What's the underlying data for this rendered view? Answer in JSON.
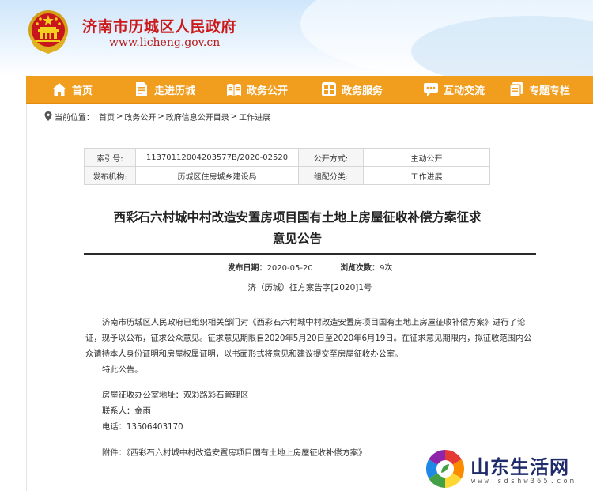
{
  "site": {
    "title": "济南市历城区人民政府",
    "url": "www.licheng.gov.cn"
  },
  "nav": {
    "items": [
      {
        "label": "首页",
        "icon": "home-icon"
      },
      {
        "label": "走进历城",
        "icon": "document-icon"
      },
      {
        "label": "政务公开",
        "icon": "open-book-icon"
      },
      {
        "label": "政务服务",
        "icon": "grid-icon"
      },
      {
        "label": "互动交流",
        "icon": "chat-icon"
      },
      {
        "label": "专题专栏",
        "icon": "folder-icon"
      }
    ],
    "bg_color": "#f19d1e"
  },
  "breadcrumb": {
    "label": "当前位置：",
    "items": [
      "首页",
      "政务公开",
      "政府信息公开目录",
      "工作进展"
    ],
    "separator": ">"
  },
  "meta": {
    "index_label": "索引号:",
    "index_value": "11370112004203577B/2020-02520",
    "disclosure_label": "公开方式:",
    "disclosure_value": "主动公开",
    "publisher_label": "发布机构:",
    "publisher_value": "历城区住房城乡建设局",
    "category_label": "组配分类:",
    "category_value": "工作进展"
  },
  "article": {
    "title_line1": "西彩石六村城中村改造安置房项目国有土地上房屋征收补偿方案征求",
    "title_line2": "意见公告",
    "date_label": "发布日期：",
    "date_value": "2020-05-20",
    "views_label": "浏览次数：",
    "views_value": "9次",
    "doc_number": "济（历城）征方案告字[2020]1号",
    "para1": "济南市历城区人民政府已组织相关部门对《西彩石六村城中村改造安置房项目国有土地上房屋征收补偿方案》进行了论证，现予以公布，征求公众意见。征求意见期限自2020年5月20日至2020年6月19日。在征求意见期限内，拟征收范围内公众请持本人身份证明和房屋权属证明，以书面形式将意见和建议提交至房屋征收办公室。",
    "para2": "特此公告。",
    "office_address": "房屋征收办公室地址：双彩路彩石管理区",
    "contact": "联系人：金雨",
    "phone": "电话：13506403170",
    "attachment_label": "附件：",
    "attachment_link": "《西彩石六村城中村改造安置房项目国有土地上房屋征收补偿方案》"
  },
  "watermark": {
    "name": "山东生活网",
    "url": "www.sdshw365.com"
  }
}
